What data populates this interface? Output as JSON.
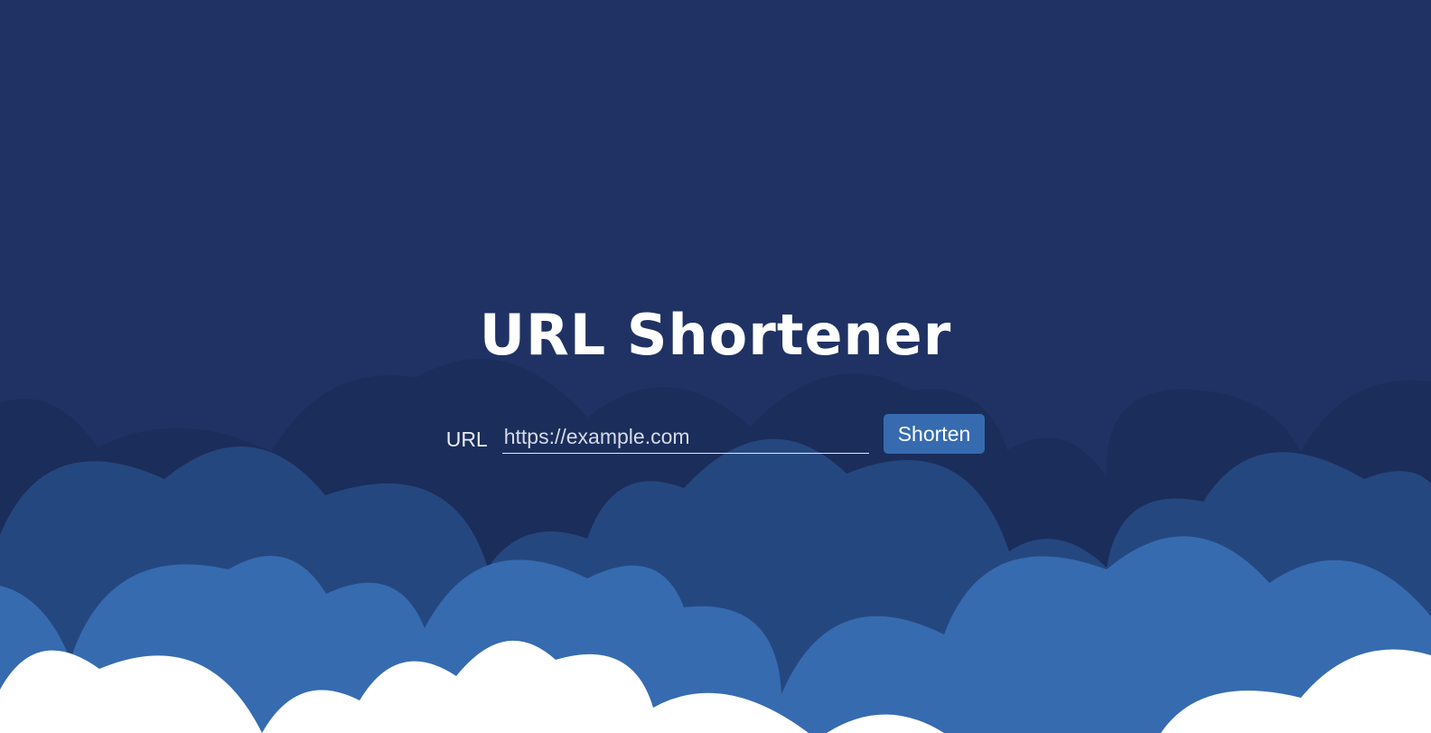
{
  "page": {
    "title": "URL Shortener"
  },
  "form": {
    "label": "URL",
    "input_value": "",
    "input_placeholder": "https://example.com",
    "button_label": "Shorten"
  },
  "colors": {
    "background": "#203264",
    "cloud_back": "#1b2d5a",
    "cloud_mid": "#25477f",
    "cloud_front": "#366bb0",
    "cloud_white": "#ffffff",
    "accent": "#366bb0"
  }
}
